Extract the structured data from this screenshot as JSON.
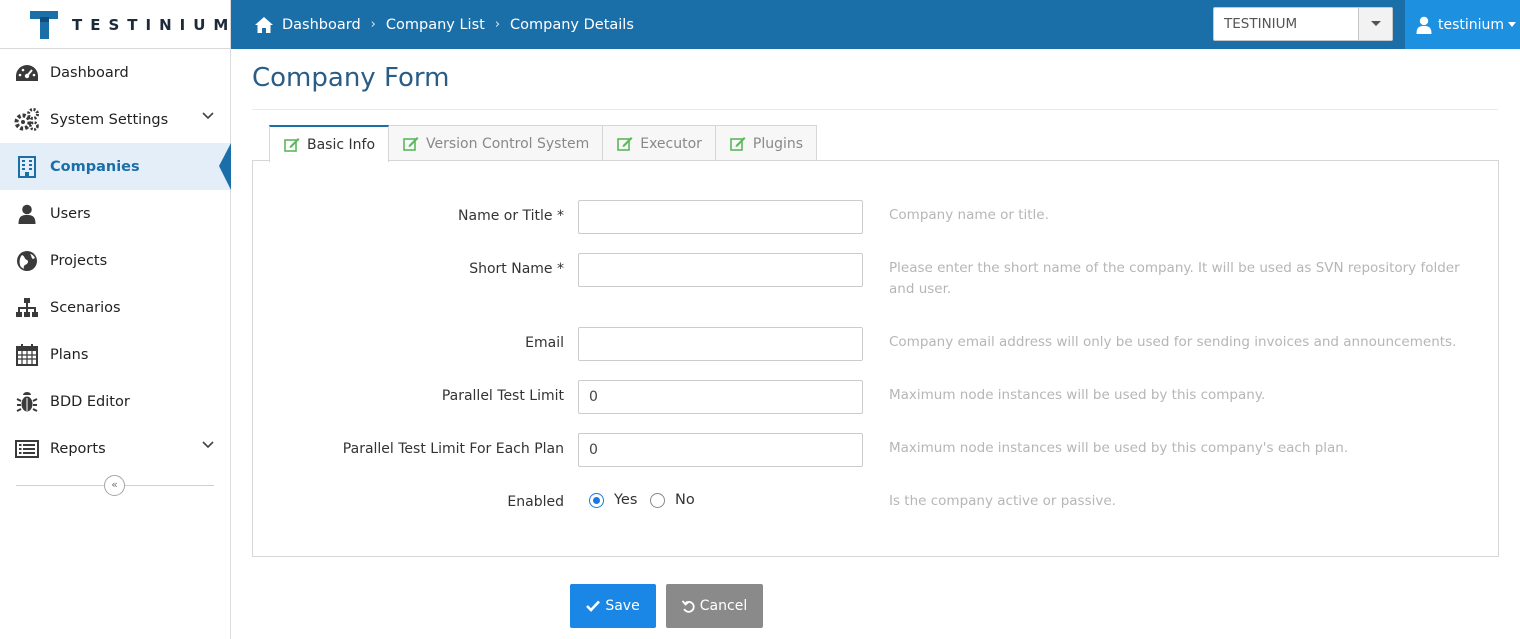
{
  "brand": {
    "name": "TESTINIUM"
  },
  "breadcrumb": {
    "items": [
      "Dashboard",
      "Company List",
      "Company Details"
    ]
  },
  "header": {
    "company_selected": "TESTINIUM",
    "username": "testinium"
  },
  "sidebar": {
    "items": [
      {
        "label": "Dashboard",
        "icon": "dashboard-icon"
      },
      {
        "label": "System Settings",
        "icon": "gears-icon",
        "expandable": true
      },
      {
        "label": "Companies",
        "icon": "building-icon",
        "active": true
      },
      {
        "label": "Users",
        "icon": "user-icon"
      },
      {
        "label": "Projects",
        "icon": "globe-icon"
      },
      {
        "label": "Scenarios",
        "icon": "sitemap-icon"
      },
      {
        "label": "Plans",
        "icon": "calendar-icon"
      },
      {
        "label": "BDD Editor",
        "icon": "bug-icon"
      },
      {
        "label": "Reports",
        "icon": "list-alt-icon",
        "expandable": true
      }
    ]
  },
  "main": {
    "title": "Company Form",
    "tabs": [
      {
        "label": "Basic Info",
        "active": true
      },
      {
        "label": "Version Control System"
      },
      {
        "label": "Executor"
      },
      {
        "label": "Plugins"
      }
    ],
    "form": {
      "name": {
        "label": "Name or Title",
        "required": "*",
        "value": "",
        "help": "Company name or title."
      },
      "short_name": {
        "label": "Short Name",
        "required": "*",
        "value": "",
        "help": "Please enter the short name of the company. It will be used as SVN repository folder and user."
      },
      "email": {
        "label": "Email",
        "value": "",
        "help": "Company email address will only be used for sending invoices and announcements."
      },
      "parallel_limit": {
        "label": "Parallel Test Limit",
        "value": "0",
        "help": "Maximum node instances will be used by this company."
      },
      "parallel_limit_plan": {
        "label": "Parallel Test Limit For Each Plan",
        "value": "0",
        "help": "Maximum node instances will be used by this company's each plan."
      },
      "enabled": {
        "label": "Enabled",
        "options": [
          "Yes",
          "No"
        ],
        "selected": "Yes",
        "help": "Is the company active or passive."
      }
    },
    "buttons": {
      "save": "Save",
      "cancel": "Cancel"
    }
  },
  "colors": {
    "primary": "#1a6fa9",
    "accent": "#1e90e0",
    "save": "#1a86e6",
    "cancel": "#8a8a8a",
    "tab_icon": "#5cb85c"
  }
}
